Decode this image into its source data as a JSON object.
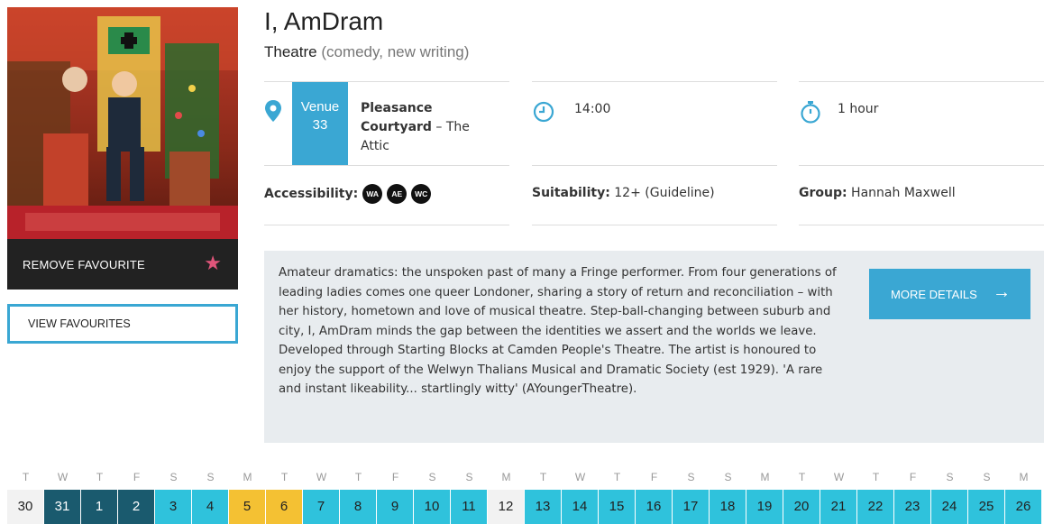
{
  "show": {
    "title": "I, AmDram",
    "category": "Theatre",
    "genres": "(comedy, new writing)"
  },
  "favourites": {
    "remove_label": "REMOVE FAVOURITE",
    "view_label": "VIEW FAVOURITES",
    "star_icon": "★"
  },
  "venue": {
    "label": "Venue",
    "number": "33",
    "name_bold": "Pleasance Courtyard",
    "name_rest": " – The Attic"
  },
  "time": "14:00",
  "duration": "1 hour",
  "accessibility": {
    "label": "Accessibility:",
    "badges": [
      "WA",
      "AE",
      "WC"
    ]
  },
  "suitability": {
    "label": "Suitability:",
    "value": " 12+ (Guideline)"
  },
  "group": {
    "label": "Group:",
    "value": " Hannah Maxwell"
  },
  "description": "Amateur dramatics: the unspoken past of many a Fringe performer. From four generations of leading ladies comes one queer Londoner, sharing a story of return and reconciliation – with her history, hometown and love of musical theatre. Step-ball-changing between suburb and city, I, AmDram minds the gap between the identities we assert and the worlds we leave. Developed through Starting Blocks at Camden People's Theatre. The artist is honoured to enjoy the support of the Welwyn Thalians Musical and Dramatic Society (est 1929). 'A rare and instant likeability... startlingly witty' (AYoungerTheatre).",
  "more_details": {
    "label": "MORE DETAILS",
    "arrow": "→"
  },
  "calendar": {
    "days": [
      "T",
      "W",
      "T",
      "F",
      "S",
      "S",
      "M",
      "T",
      "W",
      "T",
      "F",
      "S",
      "S",
      "M",
      "T",
      "W",
      "T",
      "F",
      "S",
      "S",
      "M",
      "T",
      "W",
      "T",
      "F",
      "S",
      "S",
      "M"
    ],
    "dates": [
      {
        "d": "30",
        "state": "none"
      },
      {
        "d": "31",
        "state": "dark"
      },
      {
        "d": "1",
        "state": "dark"
      },
      {
        "d": "2",
        "state": "dark"
      },
      {
        "d": "3",
        "state": "avail"
      },
      {
        "d": "4",
        "state": "avail"
      },
      {
        "d": "5",
        "state": "yellow"
      },
      {
        "d": "6",
        "state": "yellow"
      },
      {
        "d": "7",
        "state": "avail"
      },
      {
        "d": "8",
        "state": "avail"
      },
      {
        "d": "9",
        "state": "avail"
      },
      {
        "d": "10",
        "state": "avail"
      },
      {
        "d": "11",
        "state": "avail"
      },
      {
        "d": "12",
        "state": "none"
      },
      {
        "d": "13",
        "state": "avail"
      },
      {
        "d": "14",
        "state": "avail"
      },
      {
        "d": "15",
        "state": "avail"
      },
      {
        "d": "16",
        "state": "avail"
      },
      {
        "d": "17",
        "state": "avail"
      },
      {
        "d": "18",
        "state": "avail"
      },
      {
        "d": "19",
        "state": "avail"
      },
      {
        "d": "20",
        "state": "avail"
      },
      {
        "d": "21",
        "state": "avail"
      },
      {
        "d": "22",
        "state": "avail"
      },
      {
        "d": "23",
        "state": "avail"
      },
      {
        "d": "24",
        "state": "avail"
      },
      {
        "d": "25",
        "state": "avail"
      },
      {
        "d": "26",
        "state": "avail"
      }
    ],
    "colors": {
      "none": "#f2f2f2",
      "dark": "#1a5a6e",
      "avail": "#2fc2dc",
      "yellow": "#f4c133"
    }
  },
  "colors": {
    "accent": "#3aa7d3",
    "favourite_star": "#e0557a"
  }
}
